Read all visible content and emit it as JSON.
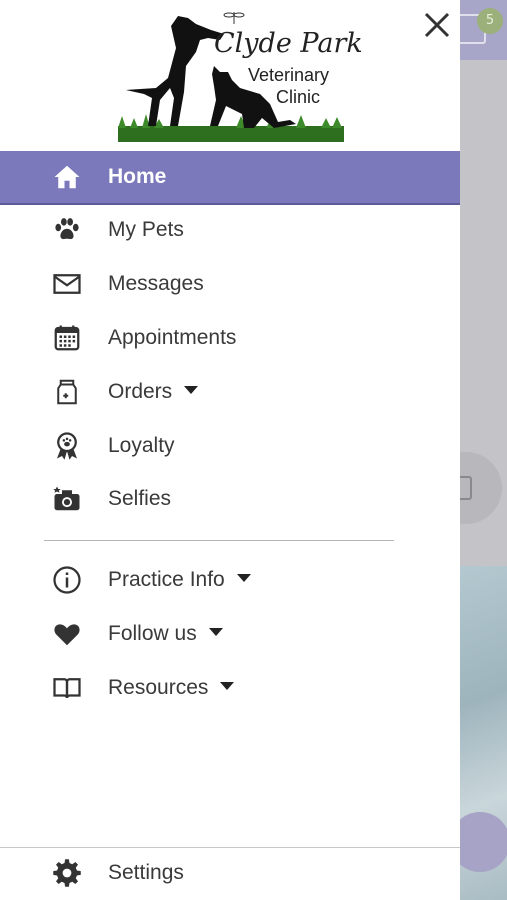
{
  "background": {
    "badge_count": "5"
  },
  "drawer": {
    "close_icon": "close-icon",
    "logo": {
      "line1": "Clyde Park",
      "line2": "Veterinary",
      "line3": "Clinic"
    },
    "items": [
      {
        "label": "Home",
        "icon": "home-icon",
        "active": true,
        "has_caret": false
      },
      {
        "label": "My Pets",
        "icon": "paw-icon",
        "active": false,
        "has_caret": false
      },
      {
        "label": "Messages",
        "icon": "envelope-icon",
        "active": false,
        "has_caret": false
      },
      {
        "label": "Appointments",
        "icon": "calendar-icon",
        "active": false,
        "has_caret": false
      },
      {
        "label": "Orders",
        "icon": "food-bag-icon",
        "active": false,
        "has_caret": true
      },
      {
        "label": "Loyalty",
        "icon": "award-ribbon-icon",
        "active": false,
        "has_caret": false
      },
      {
        "label": "Selfies",
        "icon": "camera-icon",
        "active": false,
        "has_caret": false
      }
    ],
    "secondary_items": [
      {
        "label": "Practice Info",
        "icon": "info-icon",
        "has_caret": true
      },
      {
        "label": "Follow us",
        "icon": "heart-icon",
        "has_caret": true
      },
      {
        "label": "Resources",
        "icon": "book-icon",
        "has_caret": true
      }
    ],
    "footer_item": {
      "label": "Settings",
      "icon": "gear-icon"
    }
  },
  "colors": {
    "active_bg": "#7b79bb",
    "icon": "#3a3a3a",
    "text": "#3a3a3a"
  }
}
